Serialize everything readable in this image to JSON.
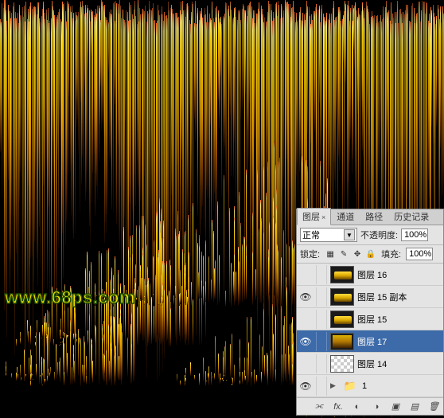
{
  "watermark": "www.68ps.com",
  "panel": {
    "tabs": {
      "layers": "图层",
      "channels": "通道",
      "paths": "路径",
      "history": "历史记录"
    },
    "blend_mode": "正常",
    "opacity_label": "不透明度:",
    "opacity_value": "100%",
    "lock_label": "锁定:",
    "fill_label": "填充:",
    "fill_value": "100%",
    "layers": [
      {
        "name": "图层 16",
        "visible": false,
        "selected": false,
        "thumb": "swatch"
      },
      {
        "name": "图层 15 副本",
        "visible": true,
        "selected": false,
        "thumb": "swatch"
      },
      {
        "name": "图层 15",
        "visible": false,
        "selected": false,
        "thumb": "swatch"
      },
      {
        "name": "图层 17",
        "visible": true,
        "selected": true,
        "thumb": "full"
      },
      {
        "name": "图层 14",
        "visible": false,
        "selected": false,
        "thumb": "trans"
      }
    ],
    "group_name": "1"
  },
  "icons": {
    "eye": "👁",
    "lock_trans": "▦",
    "lock_brush": "✎",
    "lock_move": "✥",
    "lock_all": "🔒",
    "folder": "📁",
    "link": "⫘",
    "fx": "fx.",
    "mask": "◐",
    "adj": "◑",
    "new_group": "▣",
    "new_layer": "▤",
    "trash": "🗑"
  }
}
